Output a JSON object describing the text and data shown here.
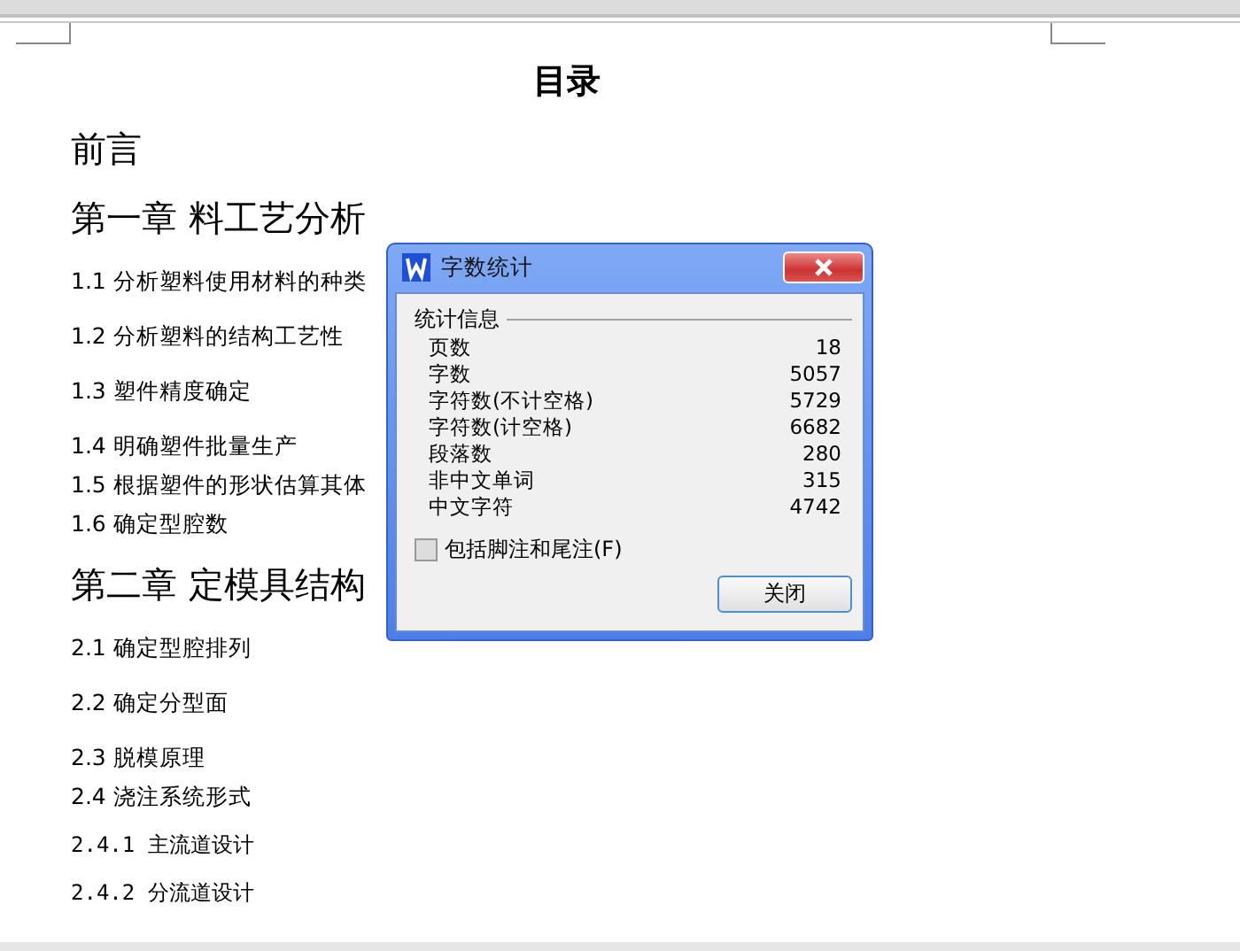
{
  "document": {
    "title": "目录",
    "entries": [
      {
        "kind": "chapter",
        "text": "前言"
      },
      {
        "kind": "chapter",
        "text": "第一章  料工艺分析"
      },
      {
        "kind": "section",
        "text": "1.1 分析塑料使用材料的种类"
      },
      {
        "kind": "section",
        "text": "1.2 分析塑料的结构工艺性"
      },
      {
        "kind": "section",
        "text": "1.3 塑件精度确定"
      },
      {
        "kind": "section",
        "text": "1.4  明确塑件批量生产"
      },
      {
        "kind": "tight",
        "text": "1.5  根据塑件的形状估算其体"
      },
      {
        "kind": "tight",
        "text": "1.6  确定型腔数"
      },
      {
        "kind": "chapter",
        "text": "第二章  定模具结构"
      },
      {
        "kind": "section",
        "text": "2.1  确定型腔排列"
      },
      {
        "kind": "section",
        "text": "2.2  确定分型面"
      },
      {
        "kind": "section",
        "text": "2.3  脱模原理"
      },
      {
        "kind": "tight",
        "text": "2.4  浇注系统形式"
      },
      {
        "kind": "subsection",
        "text": "2.4.1  主流道设计"
      },
      {
        "kind": "subsection",
        "text": "2.4.2  分流道设计"
      }
    ]
  },
  "dialog": {
    "title": "字数统计",
    "group": "统计信息",
    "stats": [
      {
        "label": "页数",
        "value": "18"
      },
      {
        "label": "字数",
        "value": "5057"
      },
      {
        "label": "字符数(不计空格)",
        "value": "5729"
      },
      {
        "label": "字符数(计空格)",
        "value": "6682"
      },
      {
        "label": "段落数",
        "value": "280"
      },
      {
        "label": "非中文单词",
        "value": "315"
      },
      {
        "label": "中文字符",
        "value": "4742"
      }
    ],
    "checkbox": {
      "label": "包括脚注和尾注(F)",
      "checked": false
    },
    "button": "关闭"
  }
}
